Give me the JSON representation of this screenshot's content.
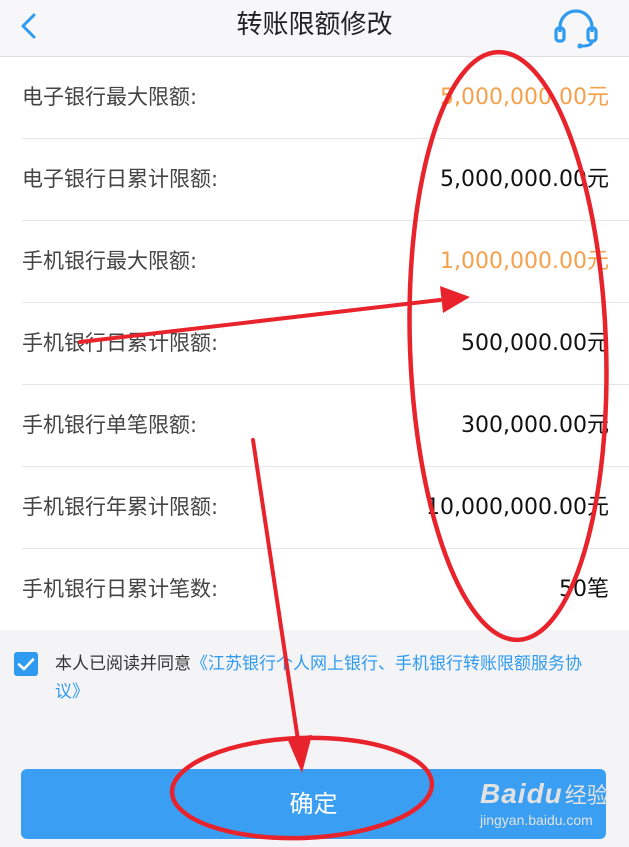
{
  "header": {
    "title": "转账限额修改",
    "back_icon": "back-icon",
    "service_icon": "customer-service-headset-icon"
  },
  "limits": [
    {
      "label": "电子银行最大限额:",
      "value": "5,000,000.00元",
      "highlight": true
    },
    {
      "label": "电子银行日累计限额:",
      "value": "5,000,000.00元",
      "highlight": false
    },
    {
      "label": "手机银行最大限额:",
      "value": "1,000,000.00元",
      "highlight": true
    },
    {
      "label": "手机银行日累计限额:",
      "value": "500,000.00元",
      "highlight": false
    },
    {
      "label": "手机银行单笔限额:",
      "value": "300,000.00元",
      "highlight": false
    },
    {
      "label": "手机银行年累计限额:",
      "value": "10,000,000.00元",
      "highlight": false
    },
    {
      "label": "手机银行日累计笔数:",
      "value": "50笔",
      "highlight": false
    }
  ],
  "agreement": {
    "checked": true,
    "text": "本人已阅读并同意",
    "link": "《江苏银行个人网上银行、手机银行转账限额服务协议》"
  },
  "confirm_label": "确定",
  "watermark": {
    "logo": "Baidu",
    "cn": "经验",
    "url": "jingyan.baidu.com"
  },
  "colors": {
    "accent": "#2f9bf0",
    "highlight_value": "#f5a04a",
    "annotation": "#e8232b"
  }
}
